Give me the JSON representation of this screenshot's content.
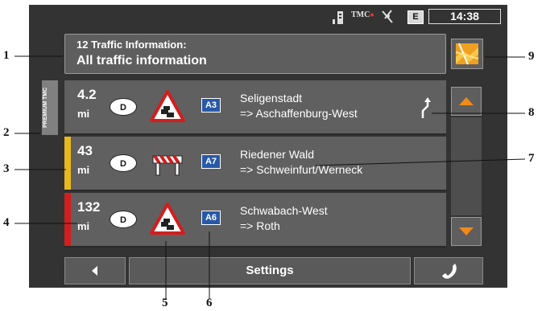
{
  "status": {
    "tmc": "TMC",
    "mode": "E",
    "time": "14:38"
  },
  "header": {
    "line1": "12 Traffic Information:",
    "line2": "All traffic information"
  },
  "premium_badge": "PREMIUM TMC",
  "traffic": [
    {
      "distance": "4.2",
      "unit": "mi",
      "country": "D",
      "road": "A3",
      "from": "Seligenstadt",
      "to": "=> Aschaffenburg-West",
      "stripe": "",
      "sign": "traffic-jam-icon"
    },
    {
      "distance": "43",
      "unit": "mi",
      "country": "D",
      "road": "A7",
      "from": "Riedener Wald",
      "to": "=> Schweinfurt/Werneck",
      "stripe": "#e8b820",
      "sign": "roadworks-icon"
    },
    {
      "distance": "132",
      "unit": "mi",
      "country": "D",
      "road": "A6",
      "from": "Schwabach-West",
      "to": "=> Roth",
      "stripe": "#d21e1e",
      "sign": "traffic-jam-icon"
    }
  ],
  "bottom": {
    "settings": "Settings"
  },
  "callouts": [
    "1",
    "2",
    "3",
    "4",
    "5",
    "6",
    "7",
    "8",
    "9"
  ]
}
